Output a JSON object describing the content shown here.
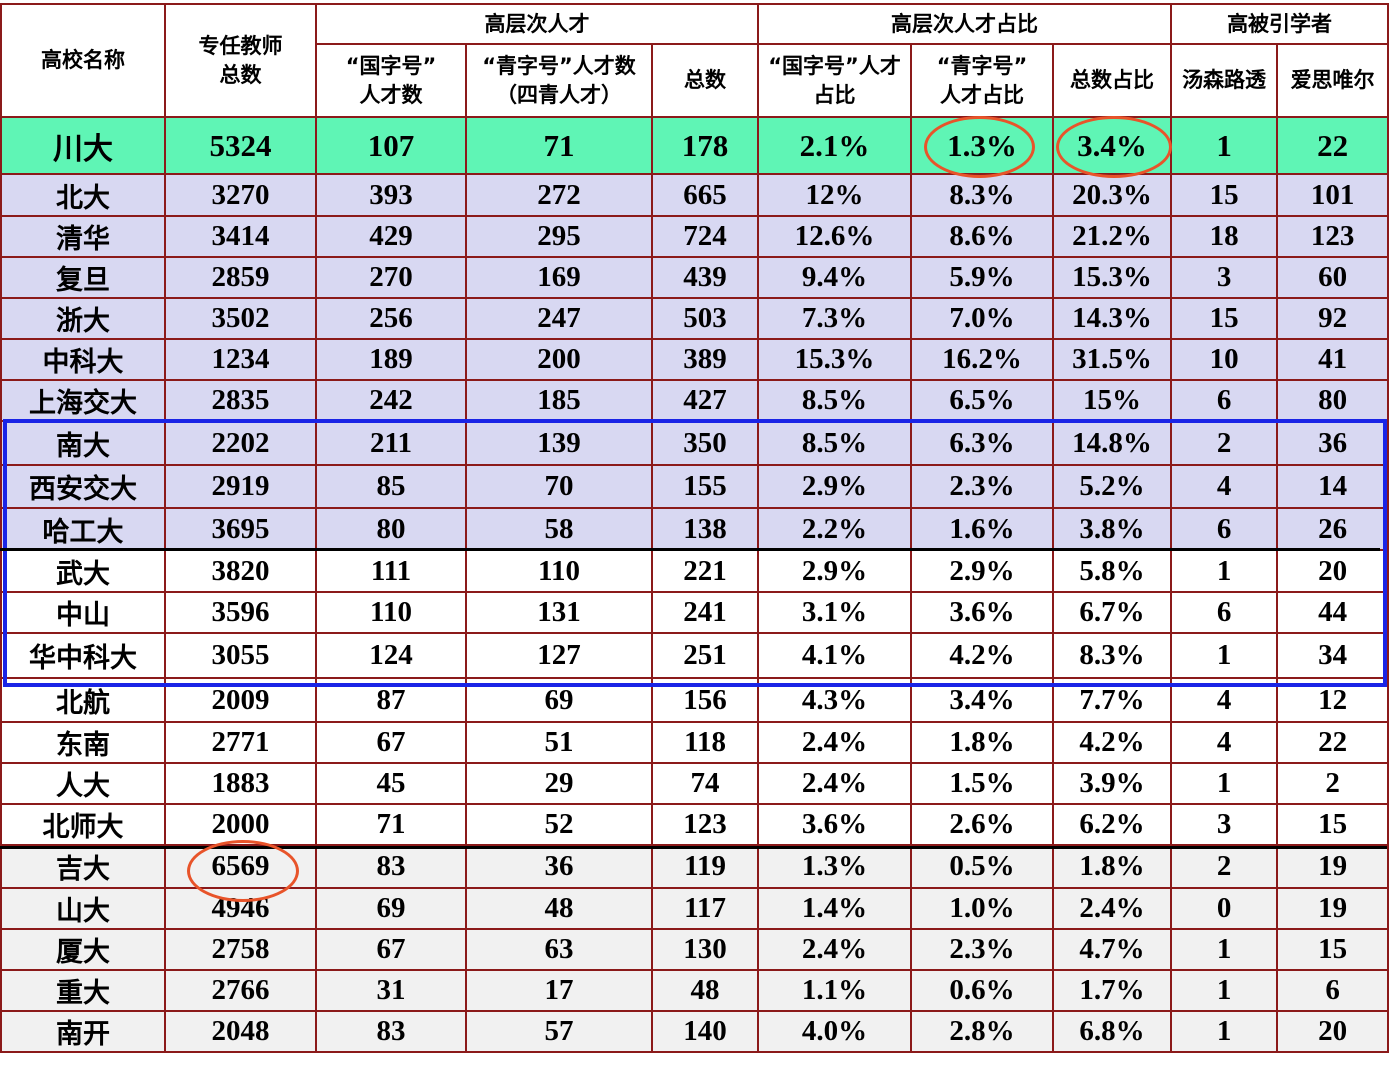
{
  "header": {
    "col_name": "高校名称",
    "col_teachers": "专任教师\n总数",
    "group_talent": "高层次人才",
    "group_ratio": "高层次人才占比",
    "group_cited": "高被引学者",
    "sub_guozi": "“国字号”\n人才数",
    "sub_qingzi": "“青字号”人才数\n（四青人才）",
    "sub_total": "总数",
    "sub_guozi_ratio": "“国字号”人才\n占比",
    "sub_qingzi_ratio": "“青字号”\n人才占比",
    "sub_total_ratio": "总数占比",
    "sub_thomson": "汤森路透",
    "sub_elsevier": "爱思唯尔"
  },
  "rows": [
    [
      "川大",
      "5324",
      "107",
      "71",
      "178",
      "2.1%",
      "1.3%",
      "3.4%",
      "1",
      "22"
    ],
    [
      "北大",
      "3270",
      "393",
      "272",
      "665",
      "12%",
      "8.3%",
      "20.3%",
      "15",
      "101"
    ],
    [
      "清华",
      "3414",
      "429",
      "295",
      "724",
      "12.6%",
      "8.6%",
      "21.2%",
      "18",
      "123"
    ],
    [
      "复旦",
      "2859",
      "270",
      "169",
      "439",
      "9.4%",
      "5.9%",
      "15.3%",
      "3",
      "60"
    ],
    [
      "浙大",
      "3502",
      "256",
      "247",
      "503",
      "7.3%",
      "7.0%",
      "14.3%",
      "15",
      "92"
    ],
    [
      "中科大",
      "1234",
      "189",
      "200",
      "389",
      "15.3%",
      "16.2%",
      "31.5%",
      "10",
      "41"
    ],
    [
      "上海交大",
      "2835",
      "242",
      "185",
      "427",
      "8.5%",
      "6.5%",
      "15%",
      "6",
      "80"
    ],
    [
      "南大",
      "2202",
      "211",
      "139",
      "350",
      "8.5%",
      "6.3%",
      "14.8%",
      "2",
      "36"
    ],
    [
      "西安交大",
      "2919",
      "85",
      "70",
      "155",
      "2.9%",
      "2.3%",
      "5.2%",
      "4",
      "14"
    ],
    [
      "哈工大",
      "3695",
      "80",
      "58",
      "138",
      "2.2%",
      "1.6%",
      "3.8%",
      "6",
      "26"
    ],
    [
      "武大",
      "3820",
      "111",
      "110",
      "221",
      "2.9%",
      "2.9%",
      "5.8%",
      "1",
      "20"
    ],
    [
      "中山",
      "3596",
      "110",
      "131",
      "241",
      "3.1%",
      "3.6%",
      "6.7%",
      "6",
      "44"
    ],
    [
      "华中科大",
      "3055",
      "124",
      "127",
      "251",
      "4.1%",
      "4.2%",
      "8.3%",
      "1",
      "34"
    ],
    [
      "北航",
      "2009",
      "87",
      "69",
      "156",
      "4.3%",
      "3.4%",
      "7.7%",
      "4",
      "12"
    ],
    [
      "东南",
      "2771",
      "67",
      "51",
      "118",
      "2.4%",
      "1.8%",
      "4.2%",
      "4",
      "22"
    ],
    [
      "人大",
      "1883",
      "45",
      "29",
      "74",
      "2.4%",
      "1.5%",
      "3.9%",
      "1",
      "2"
    ],
    [
      "北师大",
      "2000",
      "71",
      "52",
      "123",
      "3.6%",
      "2.6%",
      "6.2%",
      "3",
      "15"
    ],
    [
      "吉大",
      "6569",
      "83",
      "36",
      "119",
      "1.3%",
      "0.5%",
      "1.8%",
      "2",
      "19"
    ],
    [
      "山大",
      "4946",
      "69",
      "48",
      "117",
      "1.4%",
      "1.0%",
      "2.4%",
      "0",
      "19"
    ],
    [
      "厦大",
      "2758",
      "67",
      "63",
      "130",
      "2.4%",
      "2.3%",
      "4.7%",
      "1",
      "15"
    ],
    [
      "重大",
      "2766",
      "31",
      "17",
      "48",
      "1.1%",
      "0.6%",
      "1.7%",
      "1",
      "6"
    ],
    [
      "南开",
      "2048",
      "83",
      "57",
      "140",
      "4.0%",
      "2.8%",
      "6.8%",
      "1",
      "20"
    ]
  ],
  "colors": {
    "highlight_row": "#5ff5b5",
    "lavender_rows": "#d8d8f2",
    "gray_rows": "#f1f1f1",
    "border": "#8b1a1a",
    "blue_box": "#1a24e6",
    "circle": "#e8542a"
  }
}
